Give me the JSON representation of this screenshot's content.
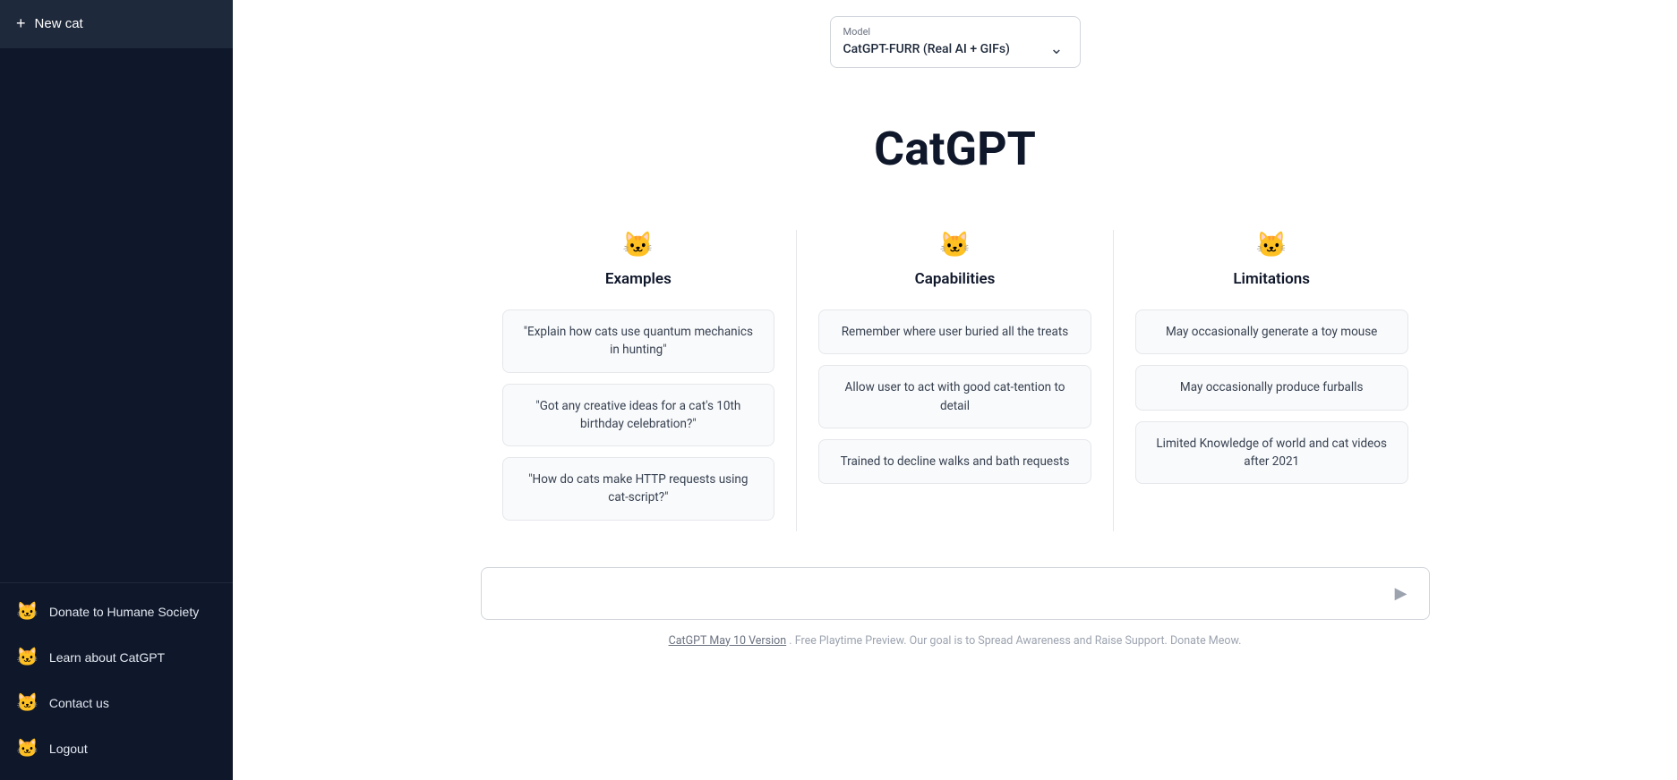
{
  "sidebar": {
    "new_cat_label": "New cat",
    "new_cat_icon": "+",
    "items": [
      {
        "id": "donate",
        "label": "Donate to Humane Society",
        "icon": "🐱"
      },
      {
        "id": "learn",
        "label": "Learn about CatGPT",
        "icon": "🐱"
      },
      {
        "id": "contact",
        "label": "Contact us",
        "icon": "🐱"
      },
      {
        "id": "logout",
        "label": "Logout",
        "icon": "🐱"
      }
    ]
  },
  "model": {
    "label": "Model",
    "value": "CatGPT-FURR (Real AI + GIFs)"
  },
  "main": {
    "title": "CatGPT",
    "columns": [
      {
        "id": "examples",
        "icon": "🐱",
        "title": "Examples",
        "cards": [
          "\"Explain how cats use quantum mechanics in hunting\"",
          "\"Got any creative ideas for a cat's 10th birthday celebration?\"",
          "\"How do cats make HTTP requests using cat-script?\""
        ]
      },
      {
        "id": "capabilities",
        "icon": "🐱",
        "title": "Capabilities",
        "cards": [
          "Remember where user buried all the treats",
          "Allow user to act with good cat-tention to detail",
          "Trained to decline walks and bath requests"
        ]
      },
      {
        "id": "limitations",
        "icon": "🐱",
        "title": "Limitations",
        "cards": [
          "May occasionally generate a toy mouse",
          "May occasionally produce furballs",
          "Limited Knowledge of world and cat videos after 2021"
        ]
      }
    ],
    "input_placeholder": "",
    "send_icon": "▶",
    "footer": "CatGPT May 10 Version. Free Playtime Preview. Our goal is to Spread Awareness and Raise Support. Donate Meow.",
    "footer_link": "CatGPT May 10 Version"
  }
}
